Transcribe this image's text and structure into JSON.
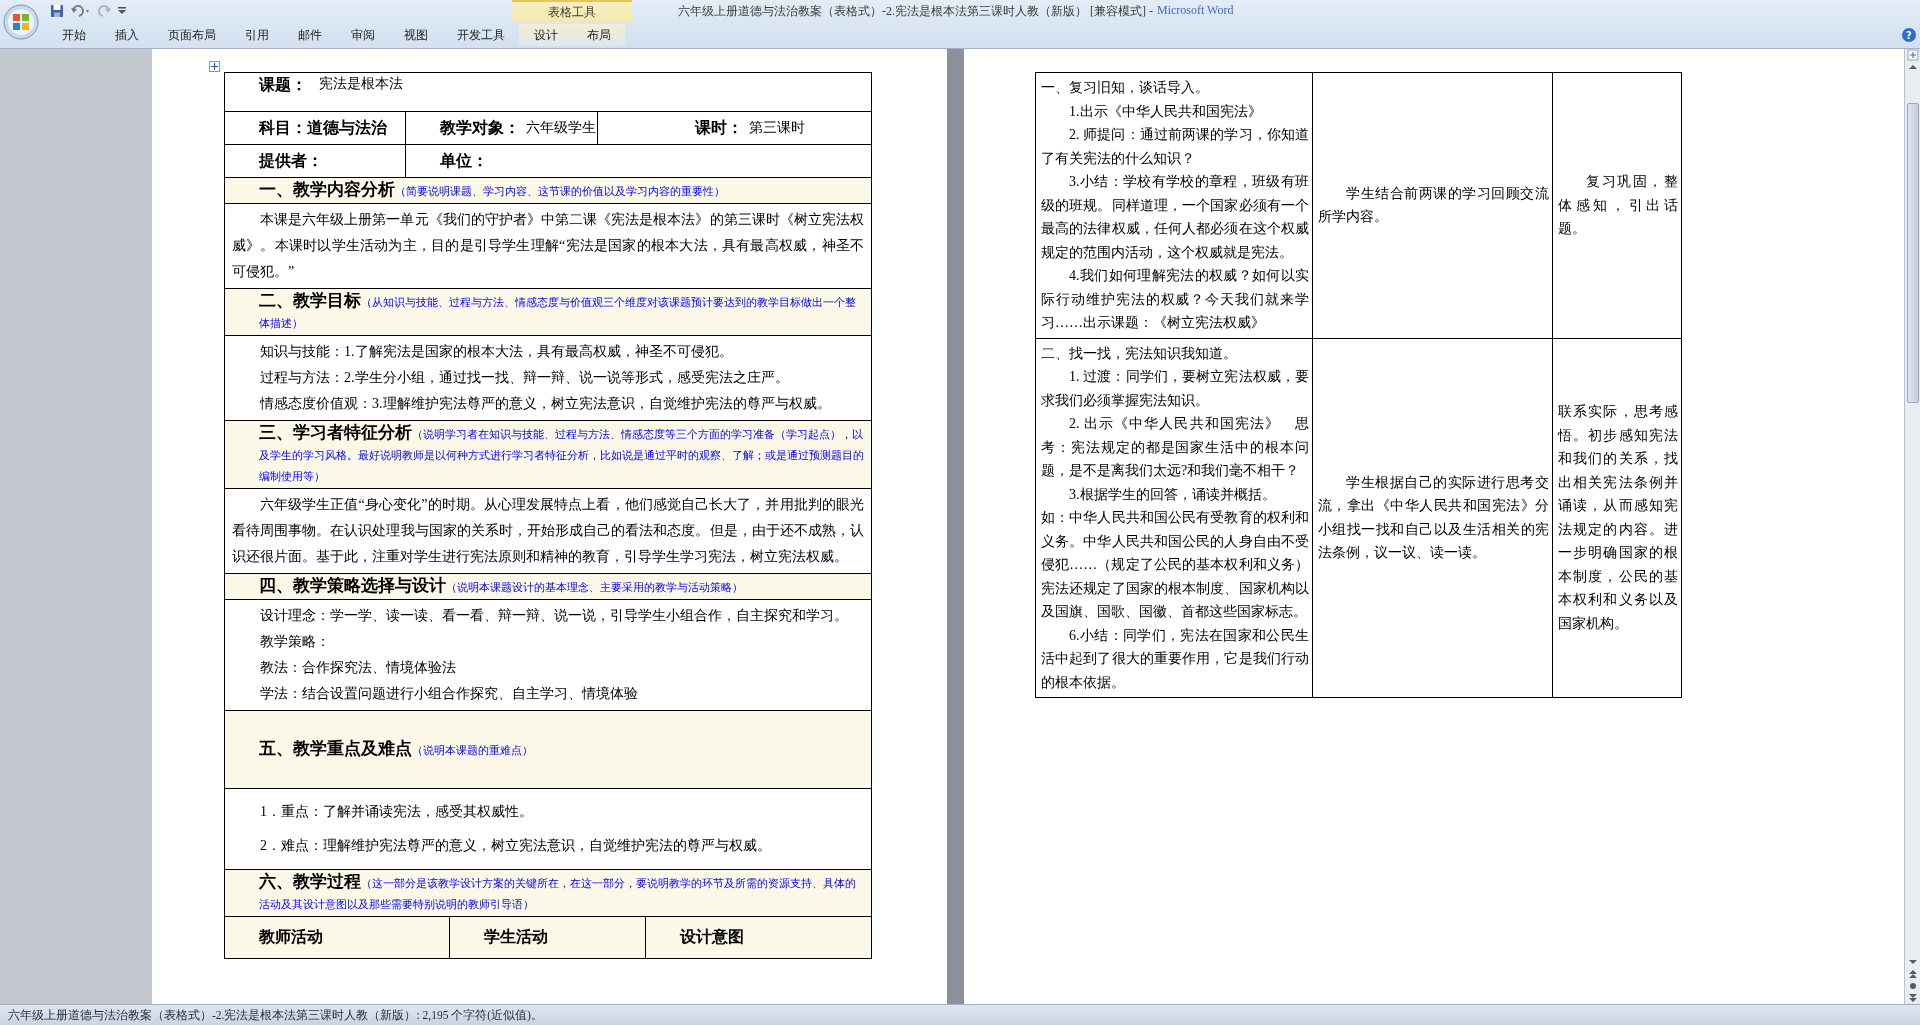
{
  "window": {
    "title": "六年级上册道德与法治教案（表格式）-2.宪法是根本法第三课时人教（新版） [兼容模式] -",
    "app_name": "Microsoft Word"
  },
  "ribbon": {
    "context_tab": "表格工具",
    "help": "?",
    "tabs": [
      {
        "label": "开始"
      },
      {
        "label": "插入"
      },
      {
        "label": "页面布局"
      },
      {
        "label": "引用"
      },
      {
        "label": "邮件"
      },
      {
        "label": "审阅"
      },
      {
        "label": "视图"
      },
      {
        "label": "开发工具"
      },
      {
        "label": "设计",
        "kind": "context"
      },
      {
        "label": "布局",
        "kind": "context"
      }
    ]
  },
  "lesson_table": {
    "rows": [
      {
        "kind": "title",
        "label": "课题：",
        "value": "宪法是根本法"
      },
      {
        "kind": "fields",
        "cells": [
          {
            "label": "科目：道德与法治"
          },
          {
            "label": "教学对象：",
            "value": "六年级学生"
          },
          {
            "label": "课时：",
            "value": "第三课时"
          }
        ]
      },
      {
        "kind": "fields",
        "cells": [
          {
            "label": "提供者："
          },
          {
            "label": "单位："
          }
        ]
      },
      {
        "kind": "section",
        "heading": "一、教学内容分析",
        "note": "（简要说明课题、学习内容、这节课的价值以及学习内容的重要性）"
      },
      {
        "kind": "body",
        "paragraphs": [
          {
            "text": "本课是六年级上册第一单元《我们的守护者》中第二课《宪法是根本法》的第三课时《树立宪法权威》。本课时以学生活动为主，目的是引导学生理解“宪法是国家的根本大法，具有最高权威，神圣不可侵犯。”",
            "indent": true
          }
        ]
      },
      {
        "kind": "section",
        "heading": "二、教学目标",
        "note": "（从知识与技能、过程与方法、情感态度与价值观三个维度对该课题预计要达到的教学目标做出一个整体描述）"
      },
      {
        "kind": "body",
        "paragraphs": [
          {
            "text": "知识与技能：1.了解宪法是国家的根本大法，具有最高权威，神圣不可侵犯。",
            "indent": true
          },
          {
            "text": "过程与方法：2.学生分小组，通过找一找、辩一辩、说一说等形式，感受宪法之庄严。",
            "indent": true
          },
          {
            "text": "情感态度价值观：3.理解维护宪法尊严的意义，树立宪法意识，自觉维护宪法的尊严与权威。",
            "indent": true
          }
        ]
      },
      {
        "kind": "section",
        "heading": "三、学习者特征分析",
        "note": "（说明学习者在知识与技能、过程与方法、情感态度等三个方面的学习准备（学习起点），以及学生的学习风格。最好说明教师是以何种方式进行学习者特征分析，比如说是通过平时的观察、了解；或是通过预测题目的编制使用等）"
      },
      {
        "kind": "body",
        "paragraphs": [
          {
            "text": "六年级学生正值“身心变化”的时期。从心理发展特点上看，他们感觉自己长大了，并用批判的眼光看待周围事物。在认识处理我与国家的关系时，开始形成自己的看法和态度。但是，由于还不成熟，认识还很片面。基于此，注重对学生进行宪法原则和精神的教育，引导学生学习宪法，树立宪法权威。",
            "indent": true
          }
        ]
      },
      {
        "kind": "section",
        "heading": "四、教学策略选择与设计",
        "note": "（说明本课题设计的基本理念、主要采用的教学与活动策略）"
      },
      {
        "kind": "body",
        "paragraphs": [
          {
            "text": "设计理念：学一学、读一读、看一看、辩一辩、说一说，引导学生小组合作，自主探究和学习。",
            "indent": true
          },
          {
            "text": "教学策略：",
            "indent": true
          },
          {
            "text": "教法：合作探究法、情境体验法",
            "indent": true
          },
          {
            "text": "学法：结合设置问题进行小组合作探究、自主学习、情境体验",
            "indent": true
          }
        ]
      },
      {
        "kind": "section",
        "heading": "五、教学重点及难点",
        "note": "（说明本课题的重难点）",
        "tall": true
      },
      {
        "kind": "body",
        "spaced": true,
        "paragraphs": [
          {
            "text": "1．重点：了解并诵读宪法，感受其权威性。",
            "indent": true
          },
          {
            "text": "2．难点：理解维护宪法尊严的意义，树立宪法意识，自觉维护宪法的尊严与权威。",
            "indent": true
          }
        ]
      },
      {
        "kind": "section",
        "heading": "六、教学过程",
        "note": "（这一部分是该教学设计方案的关键所在，在这一部分，要说明教学的环节及所需的资源支持、具体的活动及其设计意图以及那些需要特别说明的教师引导语）"
      },
      {
        "kind": "columns",
        "cells": [
          "教师活动",
          "学生活动",
          "设计意图"
        ]
      }
    ]
  },
  "process_table": {
    "rows": [
      {
        "cells": [
          {
            "paragraphs": [
              {
                "text": "一、复习旧知，谈话导入。",
                "indent": false
              },
              {
                "text": "1.出示《中华人民共和国宪法》",
                "indent": true
              },
              {
                "text": "2. 师提问：通过前两课的学习，你知道了有关宪法的什么知识？",
                "indent": true
              },
              {
                "text": "3.小结：学校有学校的章程，班级有班级的班规。同样道理，一个国家必须有一个最高的法律权威，任何人都必须在这个权威规定的范围内活动，这个权威就是宪法。",
                "indent": true
              },
              {
                "text": "4.我们如何理解宪法的权威？如何以实际行动维护宪法的权威？今天我们就来学习……出示课题：《树立宪法权威》",
                "indent": true
              }
            ]
          },
          {
            "paragraphs": [
              {
                "text": "学生结合前两课的学习回顾交流所学内容。",
                "indent": true
              }
            ]
          },
          {
            "paragraphs": [
              {
                "text": "复习巩固，整体感知，引出话题。",
                "indent": true
              }
            ]
          }
        ]
      },
      {
        "cells": [
          {
            "paragraphs": [
              {
                "text": "二、找一找，宪法知识我知道。",
                "indent": false
              },
              {
                "text": "1. 过渡：同学们，要树立宪法权威，要求我们必须掌握宪法知识。",
                "indent": true
              },
              {
                "text": "2. 出示《中华人民共和国宪法》　思考：宪法规定的都是国家生活中的根本问题，是不是离我们太远?和我们毫不相干？",
                "indent": true
              },
              {
                "text": "3.根据学生的回答，诵读并概括。",
                "indent": true
              },
              {
                "text": "如：中华人民共和国公民有受教育的权利和义务。中华人民共和国公民的人身自由不受侵犯……（规定了公民的基本权利和义务）宪法还规定了国家的根本制度、国家机构以及国旗、国歌、国徽、首都这些国家标志。",
                "indent": false
              },
              {
                "text": "6.小结：同学们，宪法在国家和公民生活中起到了很大的重要作用，它是我们行动的根本依据。",
                "indent": true
              }
            ]
          },
          {
            "paragraphs": [
              {
                "text": "学生根据自己的实际进行思考交流，拿出《中华人民共和国宪法》分小组找一找和自己以及生活相关的宪法条例，议一议、读一读。",
                "indent": true
              }
            ]
          },
          {
            "paragraphs": [
              {
                "text": "联系实际，思考感悟。初步感知宪法和我们的关系，找出相关宪法条例并诵读，从而感知宪法规定的内容。进一步明确国家的根本制度，公民的基本权利和义务以及国家机构。",
                "indent": false
              }
            ]
          }
        ]
      }
    ]
  },
  "status_bar": {
    "text": "六年级上册道德与法治教案（表格式）-2.宪法是根本法第三课时人教（新版）: 2,195 个字符(近似值)。"
  }
}
